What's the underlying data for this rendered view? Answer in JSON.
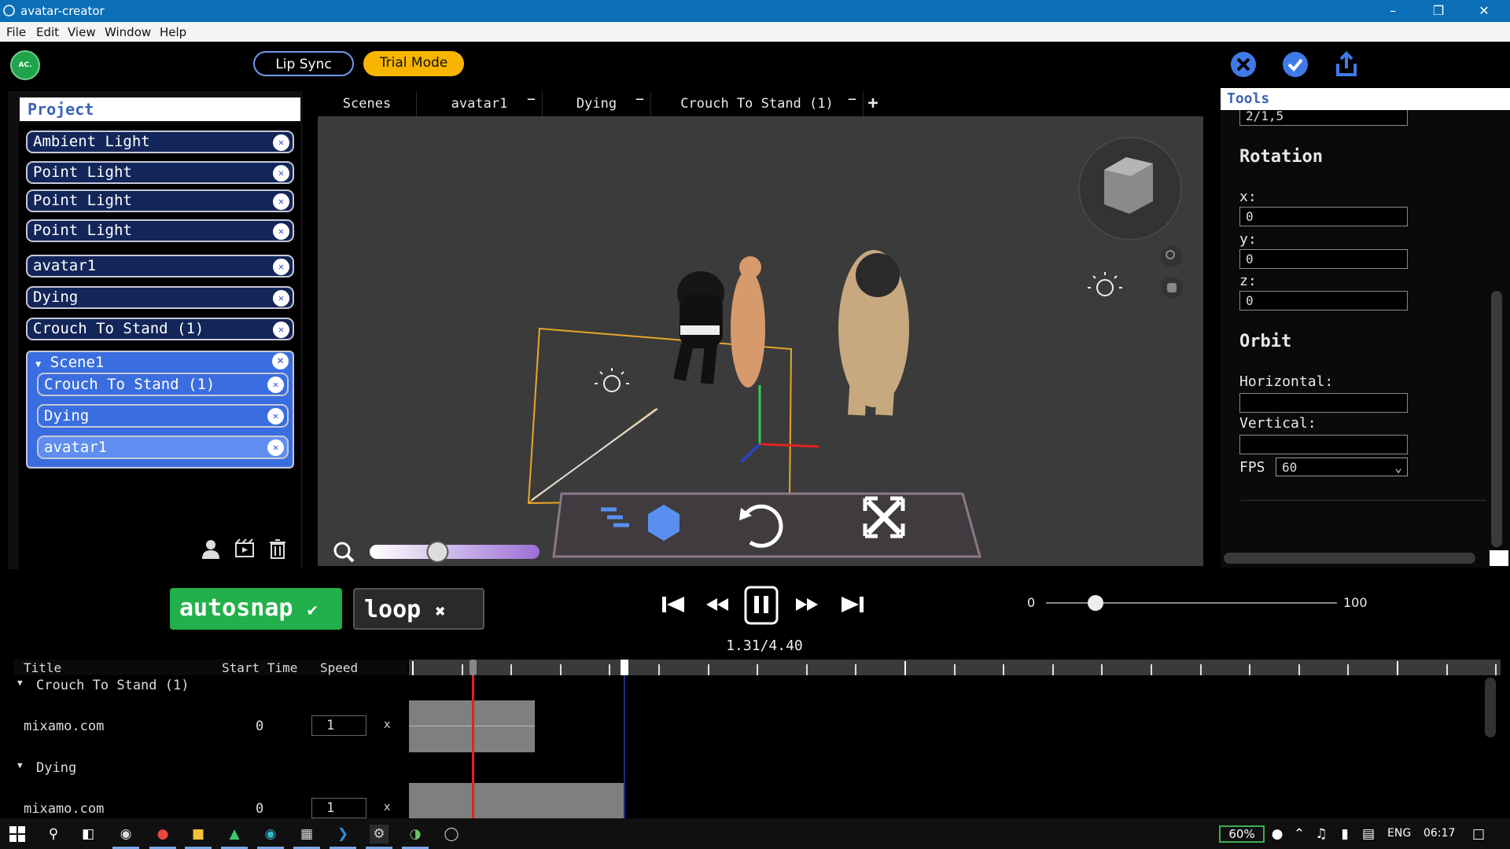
{
  "window": {
    "title": "avatar-creator"
  },
  "menu": [
    "File",
    "Edit",
    "View",
    "Window",
    "Help"
  ],
  "header": {
    "logo_text": "AC.",
    "lip_sync_label": "Lip Sync",
    "trial_mode_label": "Trial Mode"
  },
  "project": {
    "title": "Project",
    "items": [
      "Ambient Light",
      "Point Light",
      "Point Light",
      "Point Light",
      "avatar1",
      "Dying",
      "Crouch To Stand (1)"
    ],
    "scene": {
      "title": "Scene1",
      "items": [
        "Crouch To Stand (1)",
        "Dying",
        "avatar1"
      ]
    }
  },
  "tabs": [
    {
      "label": "Scenes",
      "close": ""
    },
    {
      "label": "avatar1",
      "close": "−"
    },
    {
      "label": "Dying",
      "close": "−"
    },
    {
      "label": "Crouch To Stand (1)",
      "close": "−"
    }
  ],
  "add_tab": "+",
  "tools": {
    "title": "Tools",
    "clipped_value": "2/1,5",
    "rotation_heading": "Rotation",
    "x_label": "x:",
    "x_value": "0",
    "y_label": "y:",
    "y_value": "0",
    "z_label": "z:",
    "z_value": "0",
    "orbit_heading": "Orbit",
    "horizontal_label": "Horizontal:",
    "horizontal_value": "",
    "vertical_label": "Vertical:",
    "vertical_value": "",
    "fps_label": "FPS",
    "fps_value": "60"
  },
  "controls": {
    "autosnap_label": "autosnap",
    "autosnap_mark": "✔",
    "loop_label": "loop",
    "loop_mark": "✖",
    "time_display": "1.31/4.40",
    "range_min": "0",
    "range_max": "100",
    "range_value": 17
  },
  "zoom_slider": {
    "value": 0.4
  },
  "timeline": {
    "headers": {
      "title": "Title",
      "start_time": "Start Time",
      "speed": "Speed"
    },
    "groups": [
      {
        "name": "Crouch To Stand (1)",
        "row": {
          "title": "mixamo.com",
          "start": "0",
          "speed": "1",
          "x": "x"
        }
      },
      {
        "name": "Dying",
        "row": {
          "title": "mixamo.com",
          "start": "0",
          "speed": "1",
          "x": "x"
        }
      }
    ]
  },
  "taskbar": {
    "battery": "60%",
    "lang": "ENG",
    "time": "06:17"
  }
}
